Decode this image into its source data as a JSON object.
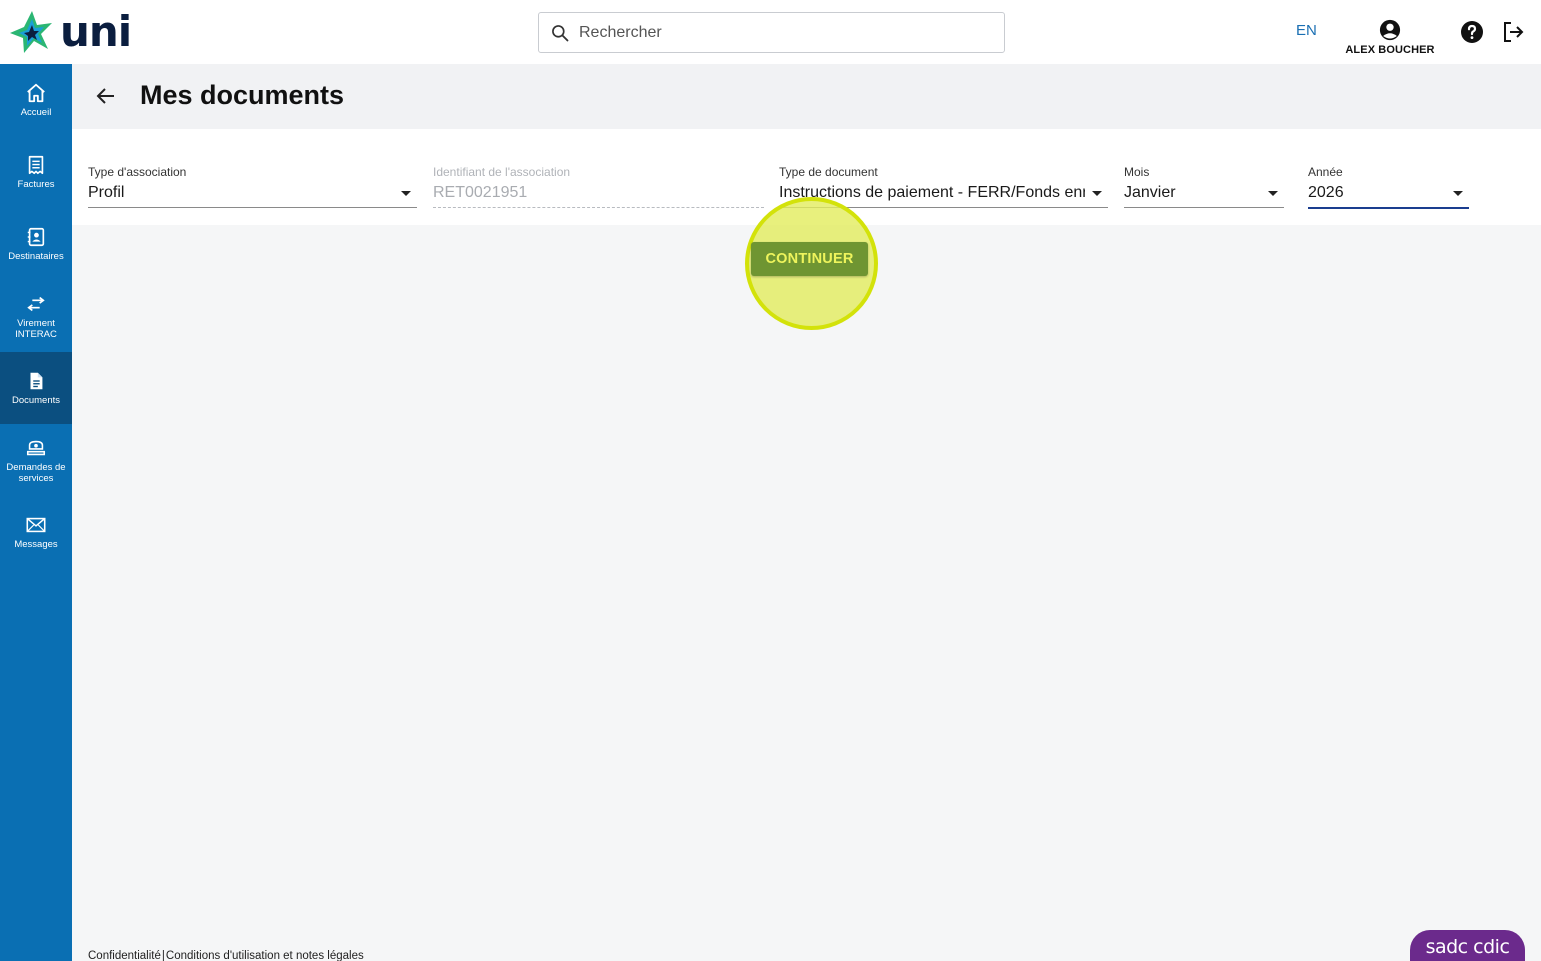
{
  "header": {
    "logo_text": "uni",
    "search_placeholder": "Rechercher",
    "lang_label": "EN",
    "user_name": "ALEX BOUCHER"
  },
  "sidebar": {
    "items": [
      {
        "label": "Accueil",
        "icon": "home-icon"
      },
      {
        "label": "Factures",
        "icon": "receipt-icon"
      },
      {
        "label": "Destinataires",
        "icon": "contacts-icon"
      },
      {
        "label": "Virement INTERAC",
        "icon": "transfer-icon"
      },
      {
        "label": "Documents",
        "icon": "document-icon",
        "active": true
      },
      {
        "label": "Demandes de services",
        "icon": "service-request-icon"
      },
      {
        "label": "Messages",
        "icon": "envelope-icon"
      }
    ]
  },
  "page": {
    "title": "Mes documents"
  },
  "filters": {
    "association_type": {
      "label": "Type d'association",
      "value": "Profil"
    },
    "association_id": {
      "label": "Identifiant de l'association",
      "value": "RET0021951"
    },
    "document_type": {
      "label": "Type de document",
      "value": "Instructions de paiement - FERR/Fonds enregistré de revenu de retraite"
    },
    "month": {
      "label": "Mois",
      "value": "Janvier"
    },
    "year": {
      "label": "Année",
      "value": "2026"
    }
  },
  "actions": {
    "continue_label": "CONTINUER"
  },
  "footer": {
    "privacy": "Confidentialité",
    "terms": "Conditions d'utilisation et notes légales",
    "separator": "|",
    "badge": "sadc cdic"
  },
  "colors": {
    "sidebar": "#0a6fb3",
    "sidebar_active": "#0b4f80",
    "button": "#6f9532",
    "highlight": "#d3e20a",
    "badge": "#6b2a8c"
  }
}
